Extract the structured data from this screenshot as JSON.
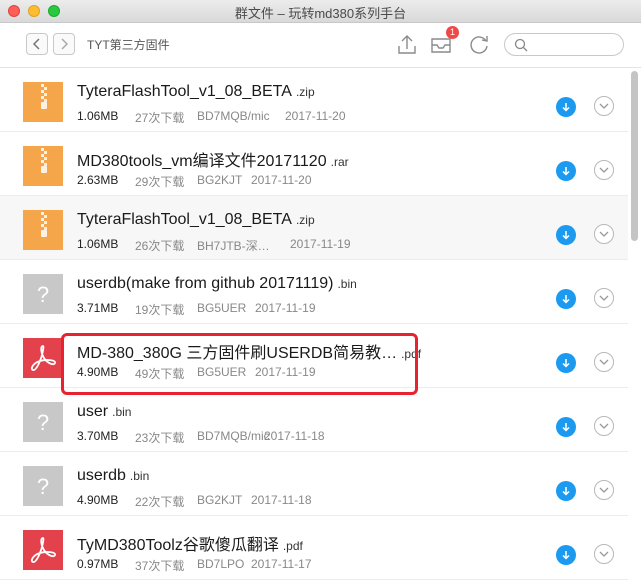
{
  "window": {
    "title": "群文件 – 玩转md380系列手台"
  },
  "toolbar": {
    "breadcrumb": "TYT第三方固件",
    "notification_count": "1",
    "search_placeholder": ""
  },
  "files": [
    {
      "name": "TyteraFlashTool_v1_08_BETA",
      "ext": ".zip",
      "type": "zip",
      "size": "1.06MB",
      "downloads": "27次下载",
      "uploader": "BD7MQB/mic",
      "date": "2017-11-20"
    },
    {
      "name": "MD380tools_vm编译文件20171120",
      "ext": ".rar",
      "type": "zip",
      "size": "2.63MB",
      "downloads": "29次下载",
      "uploader": "BG2KJT",
      "date": "2017-11-20"
    },
    {
      "name": "TyteraFlashTool_v1_08_BETA",
      "ext": ".zip",
      "type": "zip",
      "size": "1.06MB",
      "downloads": "26次下载",
      "uploader": "BH7JTB-深…",
      "date": "2017-11-19"
    },
    {
      "name": "userdb(make from github 20171119)",
      "ext": ".bin",
      "type": "unknown",
      "size": "3.71MB",
      "downloads": "19次下载",
      "uploader": "BG5UER",
      "date": "2017-11-19"
    },
    {
      "name": "MD-380_380G 三方固件刷USERDB简易教…",
      "ext": ".pdf",
      "type": "pdf",
      "size": "4.90MB",
      "downloads": "49次下载",
      "uploader": "BG5UER",
      "date": "2017-11-19"
    },
    {
      "name": "user",
      "ext": ".bin",
      "type": "unknown",
      "size": "3.70MB",
      "downloads": "23次下载",
      "uploader": "BD7MQB/mic",
      "date": "2017-11-18"
    },
    {
      "name": "userdb",
      "ext": ".bin",
      "type": "unknown",
      "size": "4.90MB",
      "downloads": "22次下载",
      "uploader": "BG2KJT",
      "date": "2017-11-18"
    },
    {
      "name": "TyMD380Toolz谷歌傻瓜翻译",
      "ext": ".pdf",
      "type": "pdf",
      "size": "0.97MB",
      "downloads": "37次下载",
      "uploader": "BD7LPO",
      "date": "2017-11-17"
    }
  ],
  "colors": {
    "zip": "#f5a64a",
    "pdf": "#e3414b",
    "unknown": "#c8c8c8",
    "download": "#1b9af0",
    "highlight": "#e8232f"
  }
}
